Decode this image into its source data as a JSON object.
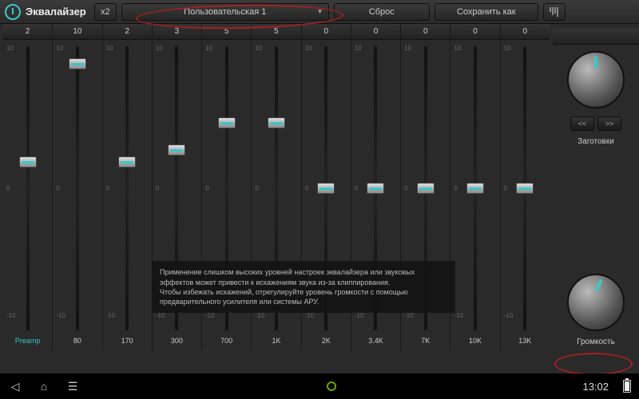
{
  "header": {
    "title": "Эквалайзер",
    "multiplier": "x2",
    "preset": "Пользовательская 1",
    "reset": "Сброс",
    "save_as": "Сохранить как"
  },
  "scale": {
    "top": "10",
    "mid": "0",
    "bottom": "-10"
  },
  "sliders": [
    {
      "val": "2",
      "freq": "Preamp",
      "pos": 41,
      "freq_class": "freq"
    },
    {
      "val": "10",
      "freq": "80",
      "pos": 8,
      "freq_class": "freq white"
    },
    {
      "val": "2",
      "freq": "170",
      "pos": 41,
      "freq_class": "freq white"
    },
    {
      "val": "3",
      "freq": "300",
      "pos": 37,
      "freq_class": "freq white"
    },
    {
      "val": "5",
      "freq": "700",
      "pos": 28,
      "freq_class": "freq white"
    },
    {
      "val": "5",
      "freq": "1K",
      "pos": 28,
      "freq_class": "freq white"
    },
    {
      "val": "0",
      "freq": "2K",
      "pos": 50,
      "freq_class": "freq white"
    },
    {
      "val": "0",
      "freq": "3.4K",
      "pos": 50,
      "freq_class": "freq white"
    },
    {
      "val": "0",
      "freq": "7K",
      "pos": 50,
      "freq_class": "freq white"
    },
    {
      "val": "0",
      "freq": "10K",
      "pos": 50,
      "freq_class": "freq white"
    },
    {
      "val": "0",
      "freq": "13K",
      "pos": 50,
      "freq_class": "freq white"
    }
  ],
  "right": {
    "prev": "<<",
    "next": ">>",
    "presets_label": "Заготовки",
    "volume_label": "Громкость"
  },
  "tooltip": {
    "line1": "Применение слишком высоких уровней настроек эквалайзера или звуковых эффектов может привести к искажениям звука из-за клиппирования.",
    "line2": "Чтобы избежать искажений, отрегулируйте уровень громкости с помощью предварительного усилителя или системы АРУ."
  },
  "nav": {
    "time": "13:02"
  }
}
